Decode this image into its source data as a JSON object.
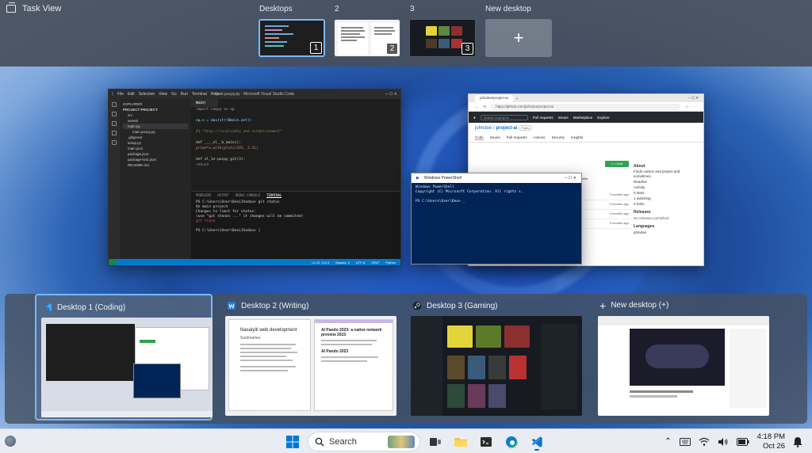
{
  "task_view": {
    "title": "Task View"
  },
  "top_desktops": [
    {
      "label": "Desktops",
      "num": "1"
    },
    {
      "label": "2",
      "num": "2"
    },
    {
      "label": "3",
      "num": "3"
    }
  ],
  "new_desktop": {
    "label": "New desktop",
    "symbol": "+"
  },
  "windows": {
    "vscode": {
      "title": "main.pucpy.py - Microsoft Visual Studio Code",
      "menu": [
        "File",
        "Edit",
        "Selection",
        "View",
        "Go",
        "Run",
        "Terminal",
        "Help"
      ],
      "explorer_header": "EXPLORER",
      "project": "PROJECT PROJECT",
      "files": [
        "src",
        "assets",
        "main.py",
        "main.pucpy.py",
        ".gitignore",
        "setup.py",
        "main.json",
        "package.json",
        "package-lock.json",
        "README.md"
      ],
      "tab": "main",
      "code": [
        "import numpy as np",
        "",
        "np.n = max(str(Bmain.ant))",
        "",
        "#1 \"http://localcadty and establishment\"",
        "",
        "def ____el__b_main():",
        "    primo*a.with(pluts(335, 2.3))",
        "",
        "def el_1n-pucpy_git(3):",
        "    return"
      ],
      "terminal_tabs": [
        "PROBLEMS",
        "OUTPUT",
        "DEBUG CONSOLE",
        "TERMINAL"
      ],
      "terminal": [
        "PS C:\\Users\\User\\DeniJhodav> git status",
        "On main project",
        "Changes to limit for status:",
        "  (use \"git stones ...\" it changes will be commited)",
        "        git trace",
        "",
        "PS C:\\Users\\User\\DeniJhodav> |"
      ],
      "status": [
        "Ln 12, Col 4",
        "Spaces: 4",
        "UTF-8",
        "CRLF",
        "Python"
      ]
    },
    "browser": {
      "tab": "johndoe/project-ai",
      "url": "https://github.com/johndoe/project-ai",
      "search": "Search or jump to...",
      "nav": [
        "Pull requests",
        "Issues",
        "Marketplace",
        "Explore"
      ],
      "owner": "johndoe",
      "repo": "project-ai",
      "visibility": "Public",
      "repo_tabs": [
        "Code",
        "Issues",
        "Pull requests",
        "Actions",
        "Security",
        "Insights"
      ],
      "code_button": "<> Code",
      "about": "About",
      "about_text": "Finds carbon and project and sometimes",
      "about_items": [
        "Readme",
        "Activity",
        "0 stars",
        "1 watching",
        "0 forks"
      ],
      "releases": "Releases",
      "releases_text": "No releases published",
      "languages": "Languages",
      "commits": "3 commits",
      "rows": [
        "2 months ago",
        "3 months ago",
        "4 months ago",
        "5 months ago"
      ]
    },
    "powershell": {
      "title": "Windows PowerShell",
      "lines": [
        "Windows PowerShell",
        "Copyright (C) Microsoft Corporation. All rights s.",
        "",
        "PS C:\\Users\\User\\Deo> _"
      ]
    }
  },
  "desktops": [
    {
      "title": "Desktop 1 (Coding)",
      "icon": "vscode-icon"
    },
    {
      "title": "Desktop 2 (Writing)",
      "icon": "word-icon"
    },
    {
      "title": "Desktop 3 (Gaming)",
      "icon": "steam-icon"
    },
    {
      "title": "New desktop (+)",
      "icon": "plus-icon"
    }
  ],
  "writing_doc": {
    "heading": "Nasaiyiti web development",
    "sub": "Summaries",
    "right_title": "AI Pando 2023: a native network preview 2023",
    "right_sub": "AI Pando 2023"
  },
  "taskbar": {
    "search_label": "Search",
    "time": "4:18 PM",
    "date": "Oct 26"
  },
  "colors": {
    "accent": "#0067c0",
    "selection": "#79b8ff",
    "vscode_blue": "#007acc",
    "ps_blue": "#012456"
  }
}
